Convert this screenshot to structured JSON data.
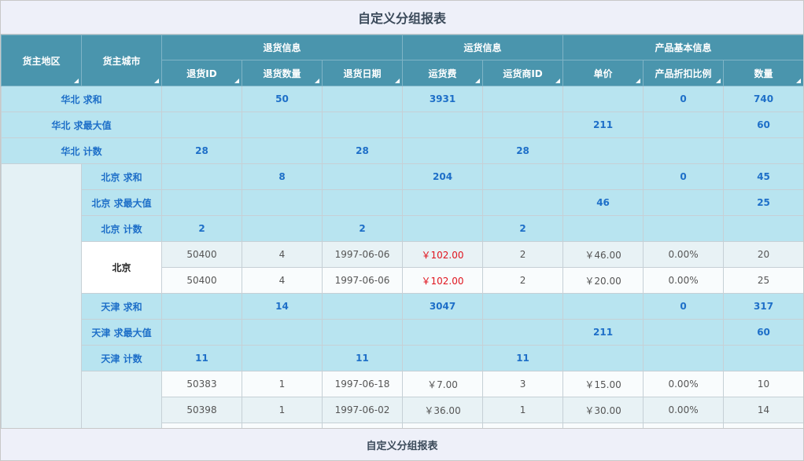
{
  "report": {
    "title": "自定义分组报表",
    "footer": "自定义分组报表"
  },
  "columns": {
    "region": "货主地区",
    "city": "货主城市",
    "group_return": "退货信息",
    "group_freight": "运货信息",
    "group_product": "产品基本信息",
    "return_id": "退货ID",
    "return_qty": "退货数量",
    "return_date": "退货日期",
    "freight": "运货费",
    "shipper_id": "运货商ID",
    "unit_price": "单价",
    "discount": "产品折扣比例",
    "quantity": "数量"
  },
  "summary_rows": [
    {
      "label": "华北 求和",
      "return_id": "",
      "return_qty": "50",
      "return_date": "",
      "freight": "3931",
      "shipper_id": "",
      "unit_price": "",
      "discount": "0",
      "quantity": "740"
    },
    {
      "label": "华北 求最大值",
      "return_id": "",
      "return_qty": "",
      "return_date": "",
      "freight": "",
      "shipper_id": "",
      "unit_price": "211",
      "discount": "",
      "quantity": "60"
    },
    {
      "label": "华北 计数",
      "return_id": "28",
      "return_qty": "",
      "return_date": "28",
      "freight": "",
      "shipper_id": "28",
      "unit_price": "",
      "discount": "",
      "quantity": ""
    }
  ],
  "beijing": {
    "city": "北京",
    "summary": [
      {
        "label": "北京 求和",
        "return_id": "",
        "return_qty": "8",
        "return_date": "",
        "freight": "204",
        "shipper_id": "",
        "unit_price": "",
        "discount": "0",
        "quantity": "45"
      },
      {
        "label": "北京 求最大值",
        "return_id": "",
        "return_qty": "",
        "return_date": "",
        "freight": "",
        "shipper_id": "",
        "unit_price": "46",
        "discount": "",
        "quantity": "25"
      },
      {
        "label": "北京 计数",
        "return_id": "2",
        "return_qty": "",
        "return_date": "2",
        "freight": "",
        "shipper_id": "2",
        "unit_price": "",
        "discount": "",
        "quantity": ""
      }
    ],
    "details": [
      {
        "return_id": "50400",
        "return_qty": "4",
        "return_date": "1997-06-06",
        "freight": "￥102.00",
        "shipper_id": "2",
        "unit_price": "￥46.00",
        "discount": "0.00%",
        "quantity": "20"
      },
      {
        "return_id": "50400",
        "return_qty": "4",
        "return_date": "1997-06-06",
        "freight": "￥102.00",
        "shipper_id": "2",
        "unit_price": "￥20.00",
        "discount": "0.00%",
        "quantity": "25"
      }
    ]
  },
  "tianjin": {
    "summary": [
      {
        "label": "天津 求和",
        "return_id": "",
        "return_qty": "14",
        "return_date": "",
        "freight": "3047",
        "shipper_id": "",
        "unit_price": "",
        "discount": "0",
        "quantity": "317"
      },
      {
        "label": "天津 求最大值",
        "return_id": "",
        "return_qty": "",
        "return_date": "",
        "freight": "",
        "shipper_id": "",
        "unit_price": "211",
        "discount": "",
        "quantity": "60"
      },
      {
        "label": "天津 计数",
        "return_id": "11",
        "return_qty": "",
        "return_date": "11",
        "freight": "",
        "shipper_id": "11",
        "unit_price": "",
        "discount": "",
        "quantity": ""
      }
    ],
    "details": [
      {
        "return_id": "50383",
        "return_qty": "1",
        "return_date": "1997-06-18",
        "freight": "￥7.00",
        "shipper_id": "3",
        "unit_price": "￥15.00",
        "discount": "0.00%",
        "quantity": "10"
      },
      {
        "return_id": "50398",
        "return_qty": "1",
        "return_date": "1997-06-02",
        "freight": "￥36.00",
        "shipper_id": "1",
        "unit_price": "￥30.00",
        "discount": "0.00%",
        "quantity": "14"
      }
    ]
  }
}
